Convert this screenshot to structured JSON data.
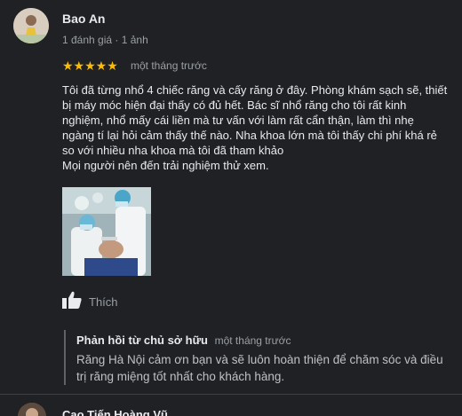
{
  "review": {
    "author": "Bao An",
    "meta": "1 đánh giá · 1 ảnh",
    "rating": 5,
    "stars": "★★★★★",
    "time": "một tháng trước",
    "lines": [
      "Tôi đã từng nhổ 4 chiếc răng và cấy răng ở đây. Phòng khám sạch sẽ, thiết",
      "bị máy móc hiện đại thấy có đủ hết. Bác sĩ nhổ răng cho tôi rất kinh",
      "nghiệm, nhổ mấy cái liền mà tư vấn với làm rất cẩn thận, làm thì nhẹ",
      "ngàng tí lại hỏi cảm thấy thế nào. Nha khoa lớn mà tôi thấy chi phí khá rẻ",
      "so với nhiều nha khoa mà tôi đã tham khảo",
      "Mọi người nên đến trải nghiệm thử xem."
    ],
    "like_label": "Thích"
  },
  "owner_reply": {
    "author": "Phản hồi từ chủ sở hữu",
    "time": "một tháng trước",
    "text": "Răng Hà Nội cảm ơn bạn và sẽ luôn hoàn thiện để chăm sóc và điều trị răng miệng tốt nhất cho khách hàng."
  },
  "next_review": {
    "author": "Cao Tiến Hoàng Vũ"
  },
  "colors": {
    "background": "#202124",
    "star": "#fbbc04",
    "text": "#e8eaed",
    "muted": "#9aa0a6"
  }
}
